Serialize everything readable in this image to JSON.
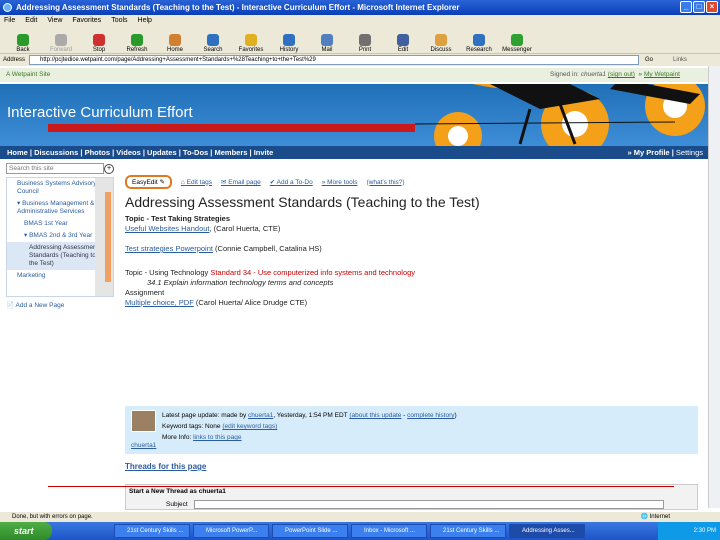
{
  "window": {
    "title": "Addressing Assessment Standards (Teaching to the Test) - Interactive Curriculum Effort - Microsoft Internet Explorer"
  },
  "menu": [
    "File",
    "Edit",
    "View",
    "Favorites",
    "Tools",
    "Help"
  ],
  "toolbar": [
    {
      "label": "Back",
      "icon": "back-arrow-icon",
      "color": "#2a9a2a",
      "enabled": true
    },
    {
      "label": "Forward",
      "icon": "forward-arrow-icon",
      "color": "#aaaaaa",
      "enabled": false
    },
    {
      "label": "Stop",
      "icon": "stop-icon",
      "color": "#d03030",
      "enabled": true
    },
    {
      "label": "Refresh",
      "icon": "refresh-icon",
      "color": "#2a9a2a",
      "enabled": true
    },
    {
      "label": "Home",
      "icon": "home-icon",
      "color": "#d08030",
      "enabled": true
    },
    {
      "label": "Search",
      "icon": "search-icon",
      "color": "#3070c0",
      "enabled": true
    },
    {
      "label": "Favorites",
      "icon": "star-icon",
      "color": "#e0b020",
      "enabled": true
    },
    {
      "label": "History",
      "icon": "history-icon",
      "color": "#3070c0",
      "enabled": true
    },
    {
      "label": "Mail",
      "icon": "mail-icon",
      "color": "#5080c0",
      "enabled": true
    },
    {
      "label": "Print",
      "icon": "print-icon",
      "color": "#707070",
      "enabled": true
    },
    {
      "label": "Edit",
      "icon": "edit-icon",
      "color": "#4060a0",
      "enabled": true
    },
    {
      "label": "Discuss",
      "icon": "discuss-icon",
      "color": "#e0a040",
      "enabled": true
    },
    {
      "label": "Research",
      "icon": "research-icon",
      "color": "#3070c0",
      "enabled": true
    },
    {
      "label": "Messenger",
      "icon": "messenger-icon",
      "color": "#30a030",
      "enabled": true
    }
  ],
  "address": {
    "label": "Address",
    "url": "http://pcjtedice.wetpaint.com/page/Addressing+Assessment+Standards+%28Teaching+to+the+Test%29",
    "go": "Go",
    "links": "Links"
  },
  "site": {
    "badge": "A Wetpaint Site",
    "signed_in_prefix": "Signed in:",
    "user": "chuerta1",
    "sign_out": "(sign out)",
    "my_wetpaint": "My Wetpaint"
  },
  "banner": {
    "title": "Interactive Curriculum Effort"
  },
  "nav": {
    "items": [
      "Home",
      "Discussions",
      "Photos",
      "Videos",
      "Updates",
      "To-Dos",
      "Members",
      "Invite"
    ],
    "my_profile": "My Profile",
    "settings": "Settings"
  },
  "sidebar": {
    "search_placeholder": "Search this site",
    "search_button": "+",
    "items": [
      {
        "label": "Business Systems Advisory Council",
        "level": 1
      },
      {
        "label": "Business Management & Administrative Services",
        "level": 1,
        "expanded": true
      },
      {
        "label": "BMAS 1st Year",
        "level": 2
      },
      {
        "label": "BMAS 2nd & 3rd Year",
        "level": 2,
        "expanded": true
      },
      {
        "label": "Addressing Assessment Standards (Teaching to the Test)",
        "level": 3,
        "selected": true
      },
      {
        "label": "Marketing",
        "level": 1
      }
    ],
    "add_page": "Add a New Page"
  },
  "actions": {
    "easyedit": "EasyEdit",
    "edit_tags": "Edit tags",
    "email": "Email page",
    "todo": "Add a To-Do",
    "more": "More tools",
    "whats_this": "(what's this?)"
  },
  "page": {
    "title": "Addressing Assessment Standards (Teaching to the Test)",
    "topic1": "Topic - Test Taking Strategies",
    "link1": "Useful Websites Handout",
    "link1_suffix": ", (Carol Huerta, CTE)",
    "link2": "Test strategies Powerpoint",
    "link2_suffix": " (Connie Campbell, Catalina HS)",
    "topic2": "Topic - Using Technology",
    "standard": "Standard 34 - Use computerized info systems and technology",
    "sub_standard": "34.1 Explain information technology terms and concepts",
    "assignment": "Assignment",
    "link3": "Multiple choice, PDF",
    "link3_suffix": " (Carol Huerta/ Alice Drudge CTE)"
  },
  "update": {
    "prefix": "Latest page update: made by",
    "user": "chuerta1",
    "time": ", Yesterday, 1:54 PM EDT",
    "about": "(about this update",
    "history": "complete history",
    "tags_text": "Keyword tags: None",
    "edit_tags": "(edit keyword tags)",
    "more_info": "More Info:",
    "links_page": "links to this page",
    "author": "chuerta1"
  },
  "threads": {
    "title": "Threads for this page",
    "new_thread": "Start a New Thread as",
    "user": "chuerta1",
    "subject_label": "Subject"
  },
  "status": {
    "text": "Done, but with errors on page.",
    "zone": "Internet"
  },
  "taskbar": {
    "start": "start",
    "tasks": [
      "21st Century Skills ...",
      "Microsoft PowerP...",
      "PowerPoint Slide ...",
      "Inbox - Microsoft ...",
      "21st Century Skills ...",
      "Addressing Asses..."
    ],
    "active_task": 5,
    "time": "2:30 PM"
  }
}
